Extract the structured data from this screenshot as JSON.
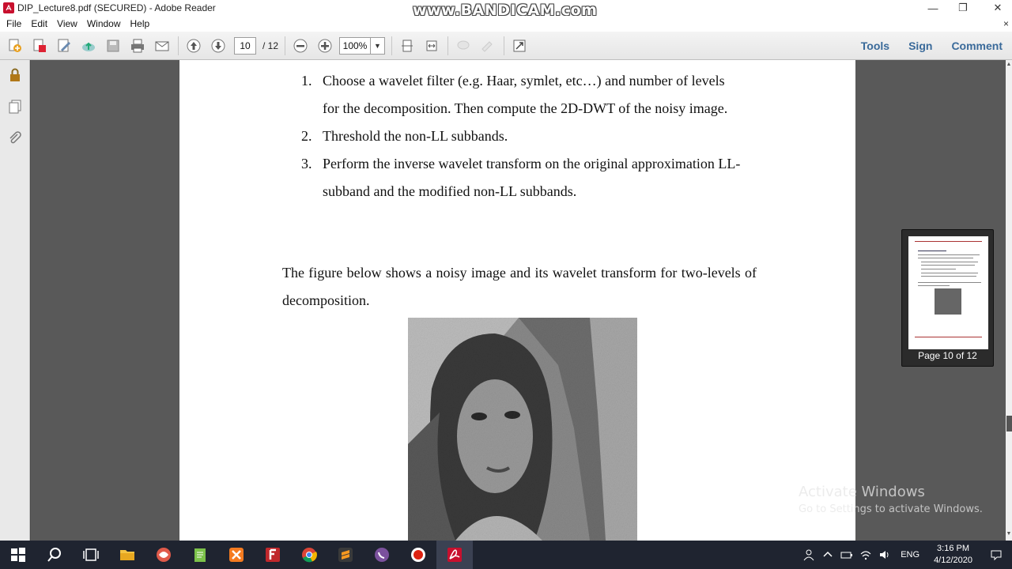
{
  "window": {
    "title": "DIP_Lecture8.pdf (SECURED) - Adobe Reader",
    "watermark": "www.BANDICAM.com",
    "minimize": "—",
    "maximize": "❐",
    "close": "✕"
  },
  "menu": {
    "items": [
      "File",
      "Edit",
      "View",
      "Window",
      "Help"
    ],
    "close": "×"
  },
  "toolbar": {
    "page_current": "10",
    "page_total": "/ 12",
    "zoom": "100%",
    "zoom_drop": "▼",
    "tools_label": "Tools",
    "sign_label": "Sign",
    "comment_label": "Comment"
  },
  "document": {
    "list": [
      {
        "num": "1.",
        "text": "Choose a wavelet filter (e.g. Haar, symlet, etc…) and number of levels for the decomposition. Then compute the 2D-DWT of the noisy image."
      },
      {
        "num": "2.",
        "text": "Threshold the non-LL subbands."
      },
      {
        "num": "3.",
        "text": "Perform the inverse wavelet transform on the original approximation LL-subband and the modified non-LL subbands."
      }
    ],
    "paragraph": "The figure below shows a noisy image and its wavelet transform for two-levels of decomposition."
  },
  "thumbnail": {
    "label": "Page 10 of 12"
  },
  "activation": {
    "title": "Activate Windows",
    "subtitle": "Go to Settings to activate Windows."
  },
  "taskbar": {
    "language": "ENG",
    "time": "3:16 PM",
    "date": "4/12/2020"
  },
  "colors": {
    "link_blue": "#3a6a9a",
    "taskbar": "#1f2430",
    "doc_bg": "#595959"
  }
}
